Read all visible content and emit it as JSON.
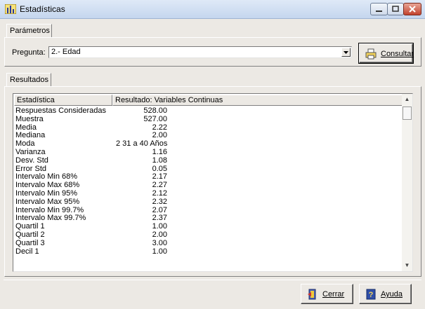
{
  "window": {
    "title": "Estadísticas"
  },
  "tabs": {
    "parametros": "Parámetros",
    "resultados": "Resultados"
  },
  "params": {
    "pregunta_label": "Pregunta:",
    "pregunta_value": "2.- Edad"
  },
  "buttons": {
    "consultar": "Consultar",
    "cerrar": "Cerrar",
    "ayuda": "Ayuda"
  },
  "grid": {
    "headers": [
      "Estadística",
      "Resultado: Variables Continuas"
    ],
    "rows": [
      [
        "Respuestas Consideradas",
        "528.00"
      ],
      [
        "Muestra",
        "527.00"
      ],
      [
        "Media",
        "2.22"
      ],
      [
        "Mediana",
        "2.00"
      ],
      [
        "Moda",
        "2 31 a 40 Años"
      ],
      [
        "Varianza",
        "1.16"
      ],
      [
        "Desv. Std",
        "1.08"
      ],
      [
        "Error Std",
        "0.05"
      ],
      [
        "Intervalo Min 68%",
        "2.17"
      ],
      [
        "Intervalo Max 68%",
        "2.27"
      ],
      [
        "Intervalo Min 95%",
        "2.12"
      ],
      [
        "Intervalo Max 95%",
        "2.32"
      ],
      [
        "Intervalo Min 99.7%",
        "2.07"
      ],
      [
        "Intervalo Max 99.7%",
        "2.37"
      ],
      [
        "Quartil 1",
        "1.00"
      ],
      [
        "Quartil 2",
        "2.00"
      ],
      [
        "Quartil 3",
        "3.00"
      ],
      [
        "Decil 1",
        "1.00"
      ]
    ]
  },
  "colors": {
    "titlebar": "#c5d6ee",
    "close": "#c2432d",
    "face": "#ece9e4"
  }
}
